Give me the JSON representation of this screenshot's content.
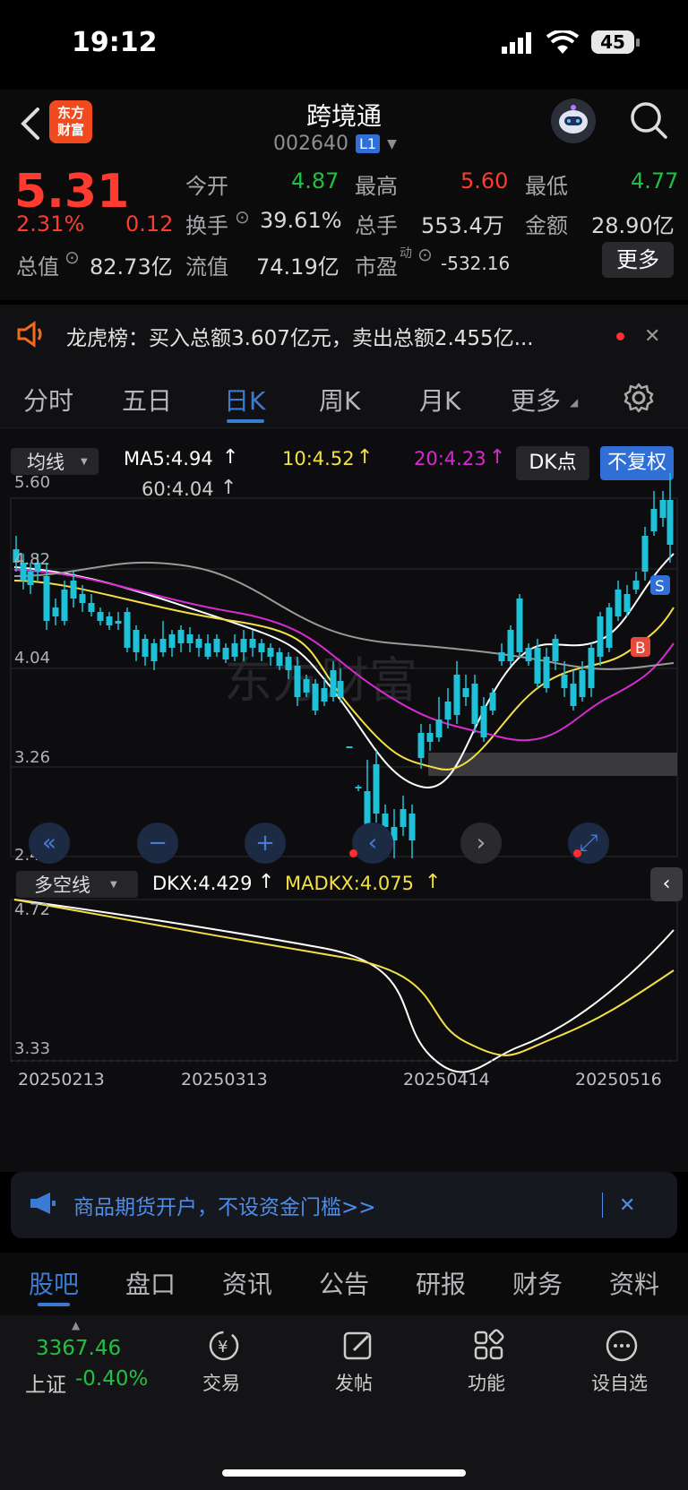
{
  "status_bar": {
    "time": "19:12",
    "battery": "45"
  },
  "header": {
    "title": "跨境通",
    "code": "002640",
    "level": "L1",
    "logo_line1": "东方",
    "logo_line2": "财富"
  },
  "quote": {
    "price": "5.31",
    "change_pct": "2.31%",
    "change": "0.12",
    "open_label": "今开",
    "open": "4.87",
    "high_label": "最高",
    "high": "5.60",
    "low_label": "最低",
    "low": "4.77",
    "turnover_label": "换手",
    "turnover": "39.61%",
    "volume_label": "总手",
    "volume": "553.4万",
    "amount_label": "金额",
    "amount": "28.90亿",
    "total_mv_label": "总值",
    "total_mv": "82.73亿",
    "float_mv_label": "流值",
    "float_mv": "74.19亿",
    "pe_label": "市盈",
    "pe_sup": "动",
    "pe": "-532.16",
    "more_button": "更多"
  },
  "tiger_list": {
    "text": "龙虎榜：买入总额3.607亿元，卖出总额2.455亿..."
  },
  "period_tabs": [
    "分时",
    "五日",
    "日K",
    "周K",
    "月K",
    "更多"
  ],
  "active_tab": "日K",
  "chart_header": {
    "indicator_select": "均线",
    "ma5": "MA5:4.94",
    "ma10": "10:4.52",
    "ma20": "20:4.23",
    "ma60": "60:4.04",
    "dk_button": "DK点",
    "adjust_button": "不复权"
  },
  "chart_data": {
    "type": "candlestick",
    "y_ticks": [
      "5.60",
      "4.82",
      "4.04",
      "3.26",
      "2.48"
    ],
    "ylim": [
      2.48,
      5.6
    ],
    "dates": [
      "20250213",
      "20250313",
      "20250414",
      "20250516"
    ],
    "markers": [
      "S",
      "B"
    ],
    "sub_chart": {
      "indicator_select": "多空线",
      "dkx": "DKX:4.429",
      "madkx": "MADKX:4.075",
      "y_ticks": [
        "4.72",
        "3.33"
      ]
    },
    "watermark": "东方财富"
  },
  "colors": {
    "up": "#ff3b30",
    "down": "#1fc1d8",
    "ma5": "#ffffff",
    "ma10": "#f3e046",
    "ma20": "#d62bd0",
    "ma60": "#bdbdbd",
    "accent": "#3a7bd5"
  },
  "ad_banner": {
    "text": "商品期货开户，不设资金门槛>>"
  },
  "sub_tabs": [
    "股吧",
    "盘口",
    "资讯",
    "公告",
    "研报",
    "财务",
    "资料"
  ],
  "active_sub_tab": "股吧",
  "bottom_bar": {
    "index_value": "3367.46",
    "index_name": "上证",
    "index_change": "-0.40%",
    "trade": "交易",
    "post": "发帖",
    "function": "功能",
    "watchlist": "设自选"
  }
}
